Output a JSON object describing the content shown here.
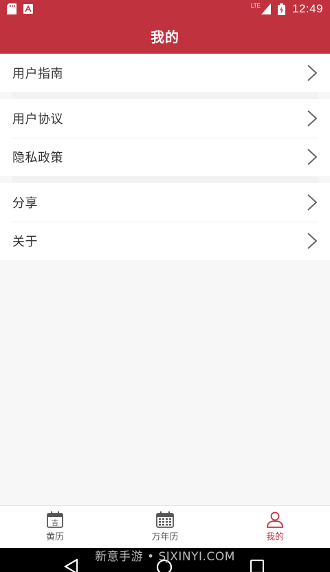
{
  "status_bar": {
    "network": "LTE",
    "time": "12:49"
  },
  "app_bar": {
    "title": "我的"
  },
  "menu": {
    "groups": [
      {
        "items": [
          {
            "label": "用户指南",
            "icon": "chevron-right-icon"
          }
        ]
      },
      {
        "items": [
          {
            "label": "用户协议",
            "icon": "chevron-right-icon"
          },
          {
            "label": "隐私政策",
            "icon": "chevron-right-icon"
          }
        ]
      },
      {
        "items": [
          {
            "label": "分享",
            "icon": "chevron-right-icon"
          },
          {
            "label": "关于",
            "icon": "chevron-right-icon"
          }
        ]
      }
    ]
  },
  "tab_bar": {
    "tabs": [
      {
        "label": "黄历",
        "icon": "calendar-day-icon",
        "icon_text": "吉",
        "active": false
      },
      {
        "label": "万年历",
        "icon": "calendar-grid-icon",
        "active": false
      },
      {
        "label": "我的",
        "icon": "user-icon",
        "active": true
      }
    ]
  },
  "nav_bar": {
    "watermark": "新意手游 • SJXINYI.COM"
  },
  "colors": {
    "brand": "#c1323f",
    "background": "#f7f7f7",
    "text": "#333333"
  }
}
